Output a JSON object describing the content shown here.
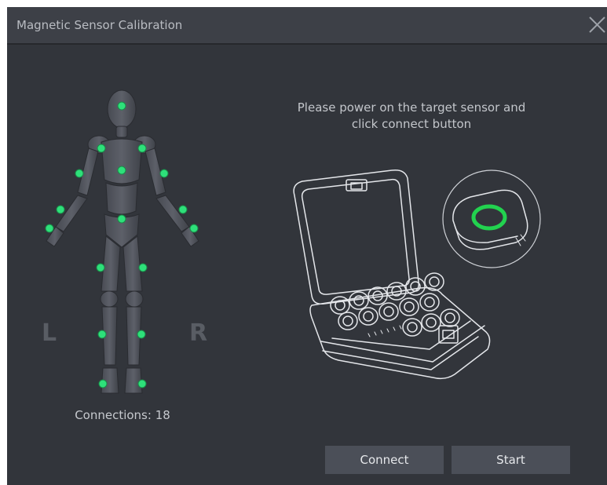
{
  "window": {
    "title": "Magnetic Sensor Calibration",
    "close_icon": "close-icon"
  },
  "body_figure": {
    "left_label": "L",
    "right_label": "R",
    "sensor_color": "#2ee07a",
    "sensor_count_shown": 17
  },
  "status": {
    "connections_text": "Connections: 18"
  },
  "instruction": {
    "line1": "Please power on the target sensor and",
    "line2": "click connect button"
  },
  "illustration": {
    "case_icon": "sensor-case-icon",
    "sensor_icon": "sensor-device-icon",
    "sensor_ring_color": "#22d24f"
  },
  "buttons": {
    "connect_label": "Connect",
    "start_label": "Start"
  }
}
